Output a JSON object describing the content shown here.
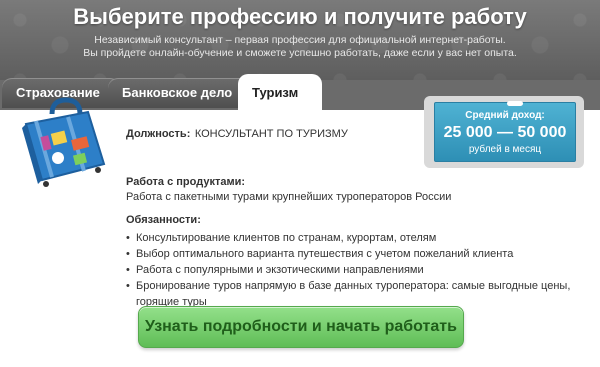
{
  "header": {
    "title": "Выберите профессию и получите работу",
    "subtitle_line1": "Независимый консультант – первая профессия для официальной интернет-работы.",
    "subtitle_line2": "Вы пройдете онлайн-обучение и сможете успешно работать, даже если у вас нет опыта."
  },
  "tabs": [
    {
      "label": "Страхование",
      "active": false
    },
    {
      "label": "Банковское дело",
      "active": false
    },
    {
      "label": "Туризм",
      "active": true
    }
  ],
  "job": {
    "position_label": "Должность:",
    "position_value": "КОНСУЛЬТАНТ ПО ТУРИЗМУ",
    "products_label": "Работа с продуктами:",
    "products_value": "Работа с пакетными турами крупнейших туроператоров России",
    "duties_label": "Обязанности:",
    "duties": [
      "Консультирование клиентов по странам, курортам, отелям",
      "Выбор оптимального варианта путешествия с учетом пожеланий клиента",
      "Работа с популярными и экзотическими направлениями",
      "Бронирование туров напрямую в базе данных туроператора: самые выгодные цены, горящие туры"
    ]
  },
  "income": {
    "label": "Средний доход:",
    "value": "25 000 — 50 000",
    "unit": "рублей в месяц"
  },
  "cta": {
    "label": "Узнать подробности и начать работать"
  },
  "colors": {
    "cta_green": "#6cc863",
    "income_blue": "#3a9fc6",
    "header_gray": "#6b6b6b"
  },
  "icons": {
    "illustration": "suitcase-icon"
  }
}
